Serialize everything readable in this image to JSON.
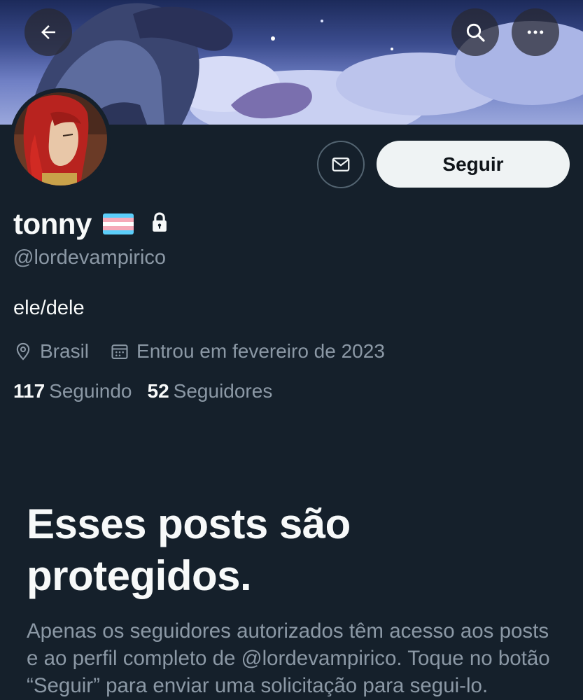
{
  "header": {
    "back_icon": "arrow-left-icon",
    "search_icon": "search-icon",
    "more_icon": "more-horizontal-icon"
  },
  "profile": {
    "display_name": "tonny",
    "flag_icon": "transgender-flag-emoji",
    "lock_icon": "lock-icon",
    "handle": "@lordevampirico",
    "bio": "ele/dele",
    "location": "Brasil",
    "joined": "Entrou em fevereiro de 2023",
    "following_count": "117",
    "following_label": "Seguindo",
    "followers_count": "52",
    "followers_label": "Seguidores"
  },
  "actions": {
    "message_icon": "envelope-icon",
    "follow_label": "Seguir"
  },
  "protected_notice": {
    "title": "Esses posts são protegidos.",
    "body": "Apenas os seguidores autorizados têm acesso aos posts e ao perfil completo de @lordevampirico. Toque no botão “Seguir” para enviar uma solicitação para segui-lo."
  },
  "colors": {
    "background": "#15202b",
    "secondary_text": "#8b98a5",
    "follow_button_bg": "#eff3f4"
  }
}
